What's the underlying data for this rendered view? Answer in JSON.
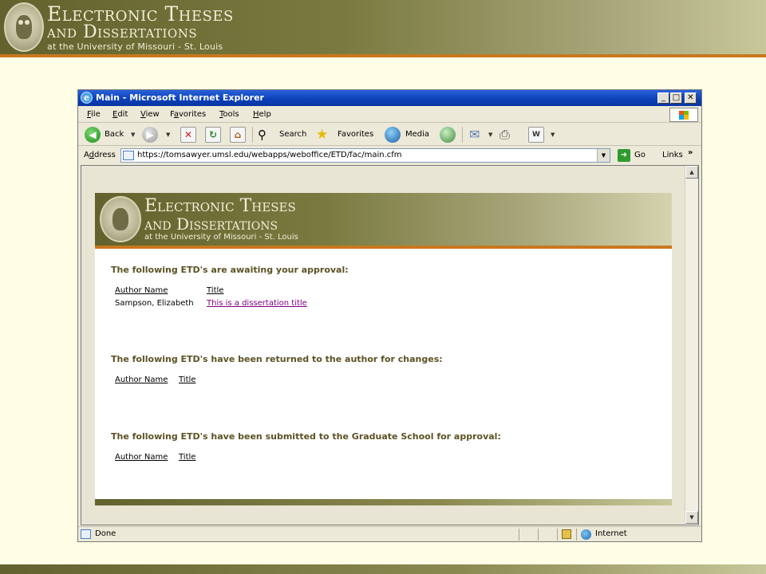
{
  "slide": {
    "banner_line1": "Electronic Theses",
    "banner_line2": "and Dissertations",
    "banner_line3": "at the University of Missouri - St. Louis"
  },
  "window": {
    "title": "Main - Microsoft Internet Explorer",
    "buttons": {
      "minimize": "_",
      "maximize": "□",
      "close": "✕"
    }
  },
  "menu": [
    {
      "key": "F",
      "rest": "ile"
    },
    {
      "key": "E",
      "rest": "dit"
    },
    {
      "key": "V",
      "rest": "iew"
    },
    {
      "pre": "F",
      "key": "a",
      "rest": "vorites"
    },
    {
      "key": "T",
      "rest": "ools"
    },
    {
      "key": "H",
      "rest": "elp"
    }
  ],
  "toolbar": {
    "back": "Back",
    "search": "Search",
    "favorites": "Favorites",
    "media": "Media"
  },
  "address": {
    "label_pre": "A",
    "label_key": "d",
    "label_rest": "dress",
    "url": "https://tomsawyer.umsl.edu/webapps/weboffice/ETD/fac/main.cfm",
    "go": "Go",
    "links": "Links"
  },
  "page": {
    "banner_line1": "Electronic Theses",
    "banner_line2": "and Dissertations",
    "banner_line3": "at the University of Missouri - St. Louis",
    "sections": [
      {
        "heading": "The following ETD's are awaiting your approval:",
        "col_author": "Author Name",
        "col_title": "Title",
        "rows": [
          {
            "author": "Sampson, Elizabeth",
            "title": "This is a dissertation title"
          }
        ]
      },
      {
        "heading": "The following ETD's have been returned to the author for changes:",
        "col_author": "Author Name",
        "col_title": "Title"
      },
      {
        "heading": "The following ETD's have been submitted to the Graduate School for approval:",
        "col_author": "Author Name",
        "col_title": "Title"
      }
    ]
  },
  "status": {
    "text": "Done",
    "zone": "Internet"
  }
}
